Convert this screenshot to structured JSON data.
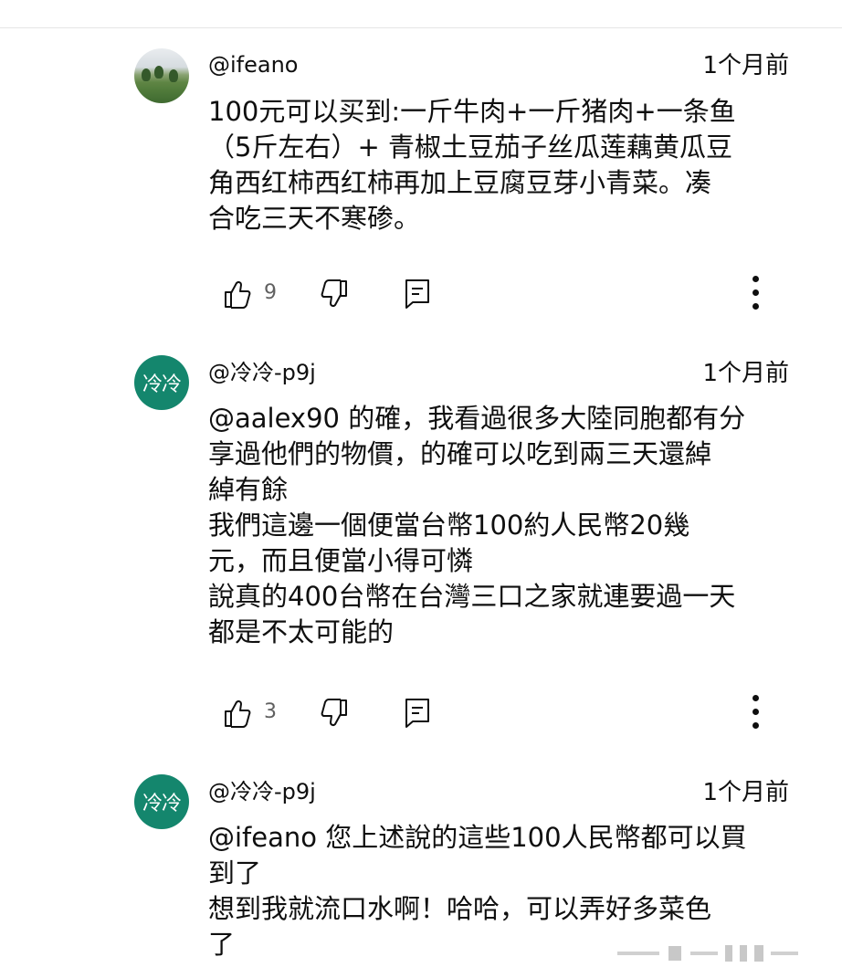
{
  "comments": [
    {
      "author": "@ifeano",
      "time": "1个月前",
      "avatar_text": "",
      "text": "100元可以买到:一斤牛肉+一斤猪肉+一条鱼\n（5斤左右）+ 青椒土豆茄子丝瓜莲藕黄瓜豆\n角西红柿西红柿再加上豆腐豆芽小青菜。凑\n合吃三天不寒碜。",
      "likes": "9"
    },
    {
      "author": "@冷冷-p9j",
      "time": "1个月前",
      "avatar_text": "冷冷",
      "text": "@aalex90 的確，我看過很多大陸同胞都有分\n享過他們的物價，的確可以吃到兩三天還綽\n綽有餘\n我們這邊一個便當台幣100約人民幣20幾\n元，而且便當小得可憐\n說真的400台幣在台灣三口之家就連要過一天\n都是不太可能的",
      "likes": "3"
    },
    {
      "author": "@冷冷-p9j",
      "time": "1个月前",
      "avatar_text": "冷冷",
      "text": "@ifeano 您上述說的這些100人民幣都可以買\n到了\n想到我就流口水啊！哈哈，可以弄好多菜色\n了",
      "likes": ""
    }
  ],
  "icons": {
    "like": "thumbs-up-icon",
    "dislike": "thumbs-down-icon",
    "reply": "reply-icon",
    "more": "more-vertical-icon"
  },
  "colors": {
    "avatar_green": "#14866d",
    "text": "#0f0f0f",
    "muted": "#606060"
  }
}
